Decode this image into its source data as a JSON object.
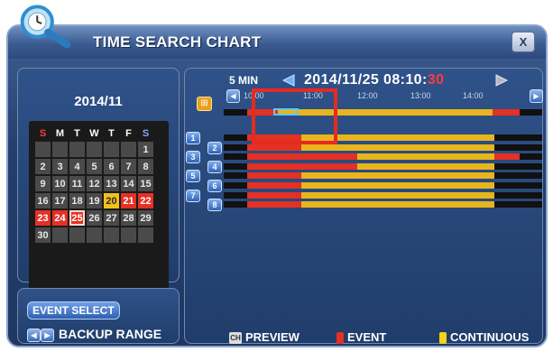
{
  "window": {
    "title": "TIME SEARCH CHART",
    "close_label": "X"
  },
  "calendar": {
    "month_label": "2014/11",
    "weekdays": [
      "S",
      "M",
      "T",
      "W",
      "T",
      "F",
      "S"
    ],
    "rows": [
      [
        "",
        "",
        "",
        "",
        "",
        "",
        "1"
      ],
      [
        "2",
        "3",
        "4",
        "5",
        "6",
        "7",
        "8"
      ],
      [
        "9",
        "10",
        "11",
        "12",
        "13",
        "14",
        "15"
      ],
      [
        "16",
        "17",
        "18",
        "19",
        "20",
        "21",
        "22"
      ],
      [
        "23",
        "24",
        "25",
        "26",
        "27",
        "28",
        "29"
      ],
      [
        "30",
        "",
        "",
        "",
        "",
        "",
        ""
      ]
    ],
    "highlight_today": "20",
    "event_days": [
      "21",
      "22",
      "23",
      "24",
      "25"
    ],
    "selected_day": "25"
  },
  "controls": {
    "event_select_label": "EVENT SELECT",
    "backup_range_label": "BACKUP RANGE"
  },
  "timeline": {
    "interval_label": "5 MIN",
    "datetime_prefix": "2014/11/25 08:10:",
    "datetime_seconds": "30",
    "hour_labels": [
      "10:00",
      "11:00",
      "12:00",
      "13:00",
      "14:00"
    ],
    "channels": [
      "1",
      "2",
      "3",
      "4",
      "5",
      "6",
      "7",
      "8"
    ]
  },
  "legend": {
    "preview_label": "PREVIEW",
    "event_label": "EVENT",
    "continuous_label": "CONTINUOUS",
    "preview_icon_text": "CH"
  },
  "colors": {
    "event": "#e53024",
    "continuous": "#e8b51d",
    "none": "#111111",
    "accent": "#f2c21a",
    "seconds": "#ff3b3b"
  }
}
